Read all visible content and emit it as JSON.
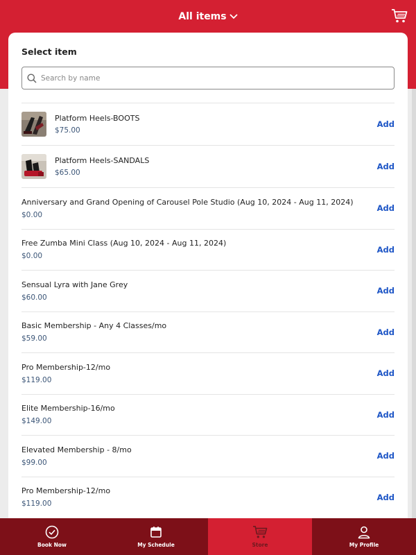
{
  "header": {
    "title": "All items",
    "title_icon": "chevron-down-icon",
    "cart_icon": "cart-icon"
  },
  "panel": {
    "title": "Select item",
    "search": {
      "placeholder": "Search by name",
      "value": ""
    }
  },
  "items": [
    {
      "name": "Platform Heels-BOOTS",
      "price": "$75.00",
      "add_label": "Add",
      "thumbnail": "boots-photo"
    },
    {
      "name": "Platform Heels-SANDALS",
      "price": "$65.00",
      "add_label": "Add",
      "thumbnail": "sandals-photo"
    },
    {
      "name": "Anniversary and Grand Opening of Carousel Pole Studio (Aug 10, 2024 - Aug 11, 2024)",
      "price": "$0.00",
      "add_label": "Add"
    },
    {
      "name": "Free Zumba Mini Class (Aug 10, 2024 - Aug 11, 2024)",
      "price": "$0.00",
      "add_label": "Add"
    },
    {
      "name": "Sensual Lyra with Jane Grey",
      "price": "$60.00",
      "add_label": "Add"
    },
    {
      "name": "Basic Membership - Any 4 Classes/mo",
      "price": "$59.00",
      "add_label": "Add"
    },
    {
      "name": "Pro Membership-12/mo",
      "price": "$119.00",
      "add_label": "Add"
    },
    {
      "name": "Elite Membership-16/mo",
      "price": "$149.00",
      "add_label": "Add"
    },
    {
      "name": "Elevated Membership - 8/mo",
      "price": "$99.00",
      "add_label": "Add"
    },
    {
      "name": "Pro Membership-12/mo",
      "price": "$119.00",
      "add_label": "Add"
    }
  ],
  "bottom_nav": [
    {
      "label": "Book Now",
      "icon": "check-circle-icon",
      "active": false
    },
    {
      "label": "My Schedule",
      "icon": "calendar-icon",
      "active": false
    },
    {
      "label": "Store",
      "icon": "cart-icon",
      "active": true
    },
    {
      "label": "My Profile",
      "icon": "user-icon",
      "active": false
    }
  ],
  "colors": {
    "brand_red": "#d42032",
    "nav_dark_red": "#7d1018",
    "link_blue": "#1e56c6",
    "price_blue": "#3b5577"
  }
}
